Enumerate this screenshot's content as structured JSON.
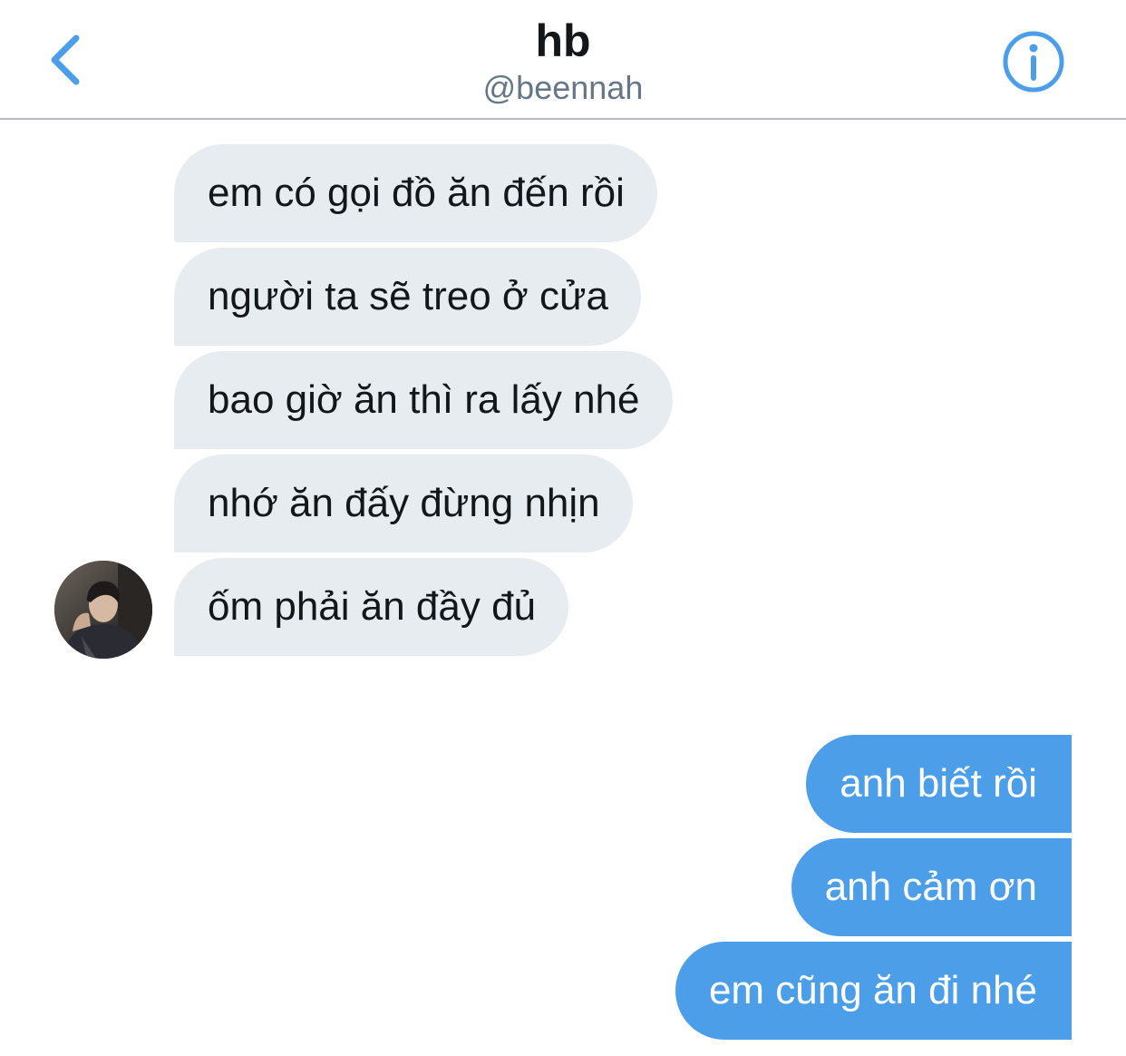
{
  "header": {
    "title": "hb",
    "handle": "@beennah",
    "back_icon": "chevron-left-icon",
    "info_icon": "info-circle-icon"
  },
  "colors": {
    "accent": "#4d9ee8",
    "incoming_bubble": "#e6ecf0",
    "incoming_text": "#14171a",
    "outgoing_text": "#ffffff",
    "handle_text": "#657786"
  },
  "conversation": {
    "incoming": [
      "em có gọi đồ ăn đến rồi",
      "người ta sẽ treo ở cửa",
      "bao giờ ăn thì ra lấy nhé",
      "nhớ ăn đấy đừng nhịn",
      "ốm phải ăn đầy đủ"
    ],
    "outgoing": [
      "anh biết rồi",
      "anh cảm ơn",
      "em cũng ăn đi nhé"
    ]
  }
}
